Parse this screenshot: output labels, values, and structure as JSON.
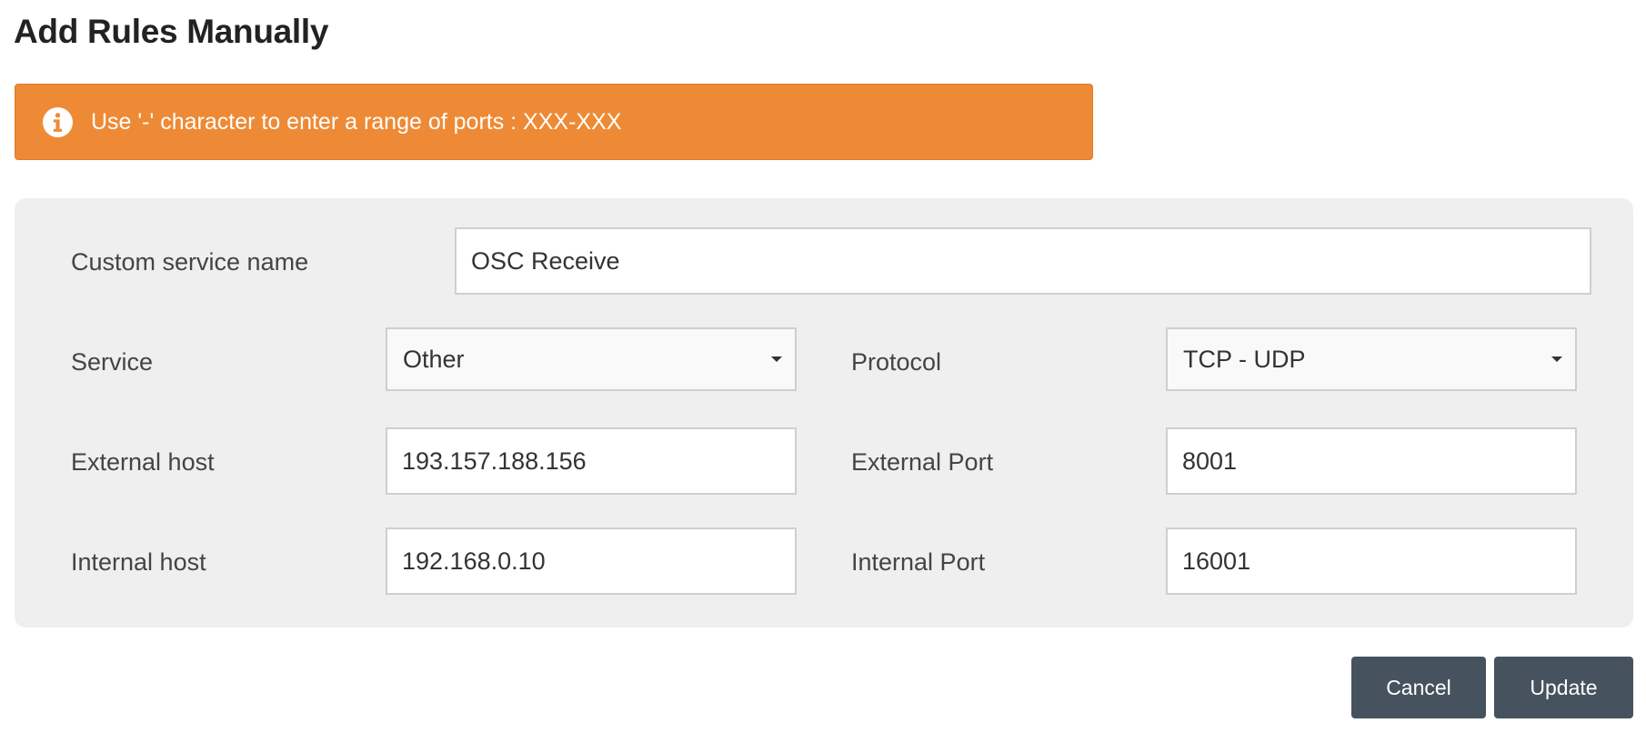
{
  "page": {
    "title": "Add Rules Manually"
  },
  "alert": {
    "icon": "info-circle-icon",
    "text": "Use '-' character to enter a range of ports : XXX-XXX",
    "color": "#ee8a35"
  },
  "form": {
    "custom_service_name": {
      "label": "Custom service name",
      "value": "OSC Receive"
    },
    "service": {
      "label": "Service",
      "selected": "Other"
    },
    "protocol": {
      "label": "Protocol",
      "selected": "TCP - UDP"
    },
    "external_host": {
      "label": "External host",
      "value": "193.157.188.156"
    },
    "external_port": {
      "label": "External Port",
      "value": "8001"
    },
    "internal_host": {
      "label": "Internal host",
      "value": "192.168.0.10"
    },
    "internal_port": {
      "label": "Internal Port",
      "value": "16001"
    }
  },
  "actions": {
    "cancel_label": "Cancel",
    "update_label": "Update",
    "button_color": "#46535e"
  }
}
